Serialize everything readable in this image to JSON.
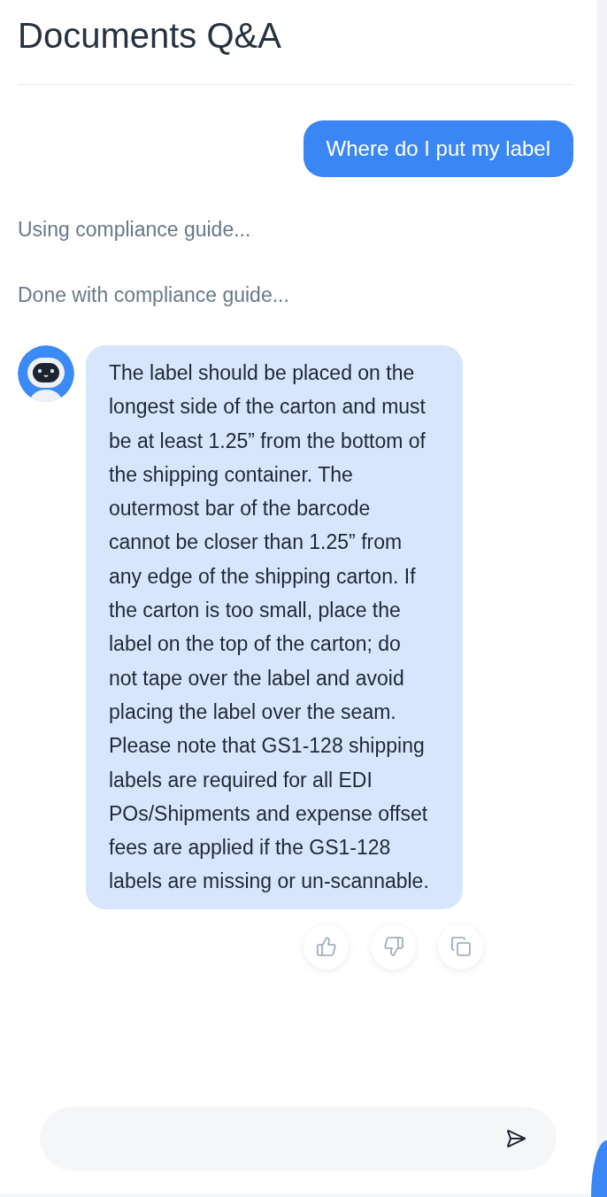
{
  "header": {
    "title": "Documents Q&A"
  },
  "messages": [
    {
      "kind": "user",
      "text": "Where do I put my label"
    },
    {
      "kind": "status",
      "text": "Using compliance guide..."
    },
    {
      "kind": "status",
      "text": "Done with compliance guide..."
    },
    {
      "kind": "bot",
      "text": "The label should be placed on the longest side of the carton and must be at least 1.25” from the bottom of the shipping container. The outermost bar of the barcode cannot be closer than 1.25” from any edge of the shipping carton. If the carton is too small, place the label on the top of the carton; do not tape over the label and avoid placing the label over the seam. Please note that GS1-128 shipping labels are required for all EDI POs/Shipments and expense offset fees are applied if the GS1-128 labels are missing or un-scannable.",
      "actions": [
        {
          "kind": "like"
        },
        {
          "kind": "dislike"
        },
        {
          "kind": "copy"
        }
      ]
    }
  ]
}
